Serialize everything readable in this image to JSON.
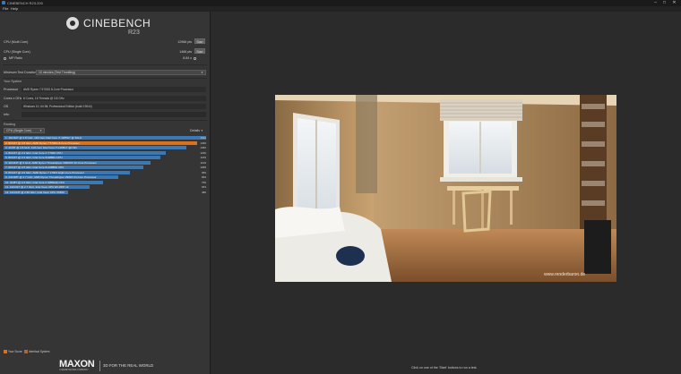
{
  "window": {
    "title": "CINEBENCH R23.200",
    "minimize": "–",
    "maximize": "□",
    "close": "✕"
  },
  "menu": {
    "file": "File",
    "help": "Help"
  },
  "logo": {
    "name": "CINEBENCH",
    "version": "R23"
  },
  "tests": [
    {
      "label": "CPU (Multi Core)",
      "score": "12966 pts",
      "button": "Start"
    },
    {
      "label": "CPU (Single Core)",
      "score": "1466 pts",
      "button": "Start"
    },
    {
      "label": "MP Ratio",
      "score": "8.84 x"
    }
  ],
  "min_test_duration": {
    "label": "Minimum Test Duration",
    "value": "10 minutes (Test Throttling)"
  },
  "your_system": {
    "heading": "Your System",
    "rows": [
      {
        "label": "Processor",
        "value": "AMD Ryzen 7 5700G 8-Core Processor"
      },
      {
        "label": "Cores x GHz",
        "value": "8 Cores, 16 Threads @ 3.8 GHz"
      },
      {
        "label": "OS",
        "value": "Windows 10, 64 Bit, Professional Edition (build 19044)"
      },
      {
        "label": "Info",
        "value": ""
      }
    ]
  },
  "ranking": {
    "heading": "Ranking",
    "dropdown": "CPU (Single Core)",
    "details": "Details",
    "items": [
      {
        "label": "1. 16C/32T @ 2.8 GHz, 11th Gen Intel Core i7-1185G7 @ 3GHz",
        "score": "1532",
        "highlight": false
      },
      {
        "label": "2. 8C/16T @ 3.8 GHz, AMD Ryzen 7 5700G 8-Core Processor",
        "score": "1466",
        "highlight": true
      },
      {
        "label": "3. 4C/8T @ 2.8 GHz, 11th Gen Intel Core i7-1165G7 @2.8G",
        "score": "1382",
        "highlight": false
      },
      {
        "label": "4. 8C/16T @ 2.3 GHz, Intel Core i7-7700K CPU",
        "score": "1230",
        "highlight": false
      },
      {
        "label": "5. 8C/16T @ 2.4 GHz, Intel Core i9-9880H CPU",
        "score": "1183",
        "highlight": false
      },
      {
        "label": "6. 32C/64T @ 3 GHz, AMD Ryzen Threadripper 2990WX 32-Core Processor",
        "score": "1109",
        "highlight": false
      },
      {
        "label": "7. 6C/12T @ 2.5 GHz, Intel Core i9-10885H CPU",
        "score": "1058",
        "highlight": false
      },
      {
        "label": "8. 8C/16T @ 3.6 GHz, AMD Ryzen 7 1700X Eight-Core Processor",
        "score": "959",
        "highlight": false
      },
      {
        "label": "9. 24C/48T @ 2.7 GHz, AMD Ryzen Threadripper 2990X 24-Core Processor",
        "score": "869",
        "highlight": false
      },
      {
        "label": "10. 4C/8T @ 2.3 GHz, Intel Core i7-4850HQ CPU",
        "score": "750",
        "highlight": false
      },
      {
        "label": "11. 12C/24T @ 2.7 GHz, Intel Xeon CPU E5-2697 v2",
        "score": "653",
        "highlight": false
      },
      {
        "label": "12. 12C/24T @ 2.66 GHz, Intel Xeon CPU X5650",
        "score": "486",
        "highlight": false
      }
    ]
  },
  "legend": {
    "your_score": {
      "label": "Your Score",
      "color": "#d9711f"
    },
    "identical": {
      "label": "Identical System",
      "color": "#a8693a"
    }
  },
  "footer": {
    "brand": "MAXON",
    "sub": "A NEMETSCHEK COMPANY",
    "tagline": "3D FOR THE REAL WORLD"
  },
  "render": {
    "watermark": "www.renderbaron.de"
  },
  "status": "Click on one of the 'Start' buttons to run a test.",
  "colors": {
    "bar": "#3c78b3",
    "highlight": "#d9711f",
    "panel": "#353535",
    "viewport": "#2b2b2b"
  }
}
